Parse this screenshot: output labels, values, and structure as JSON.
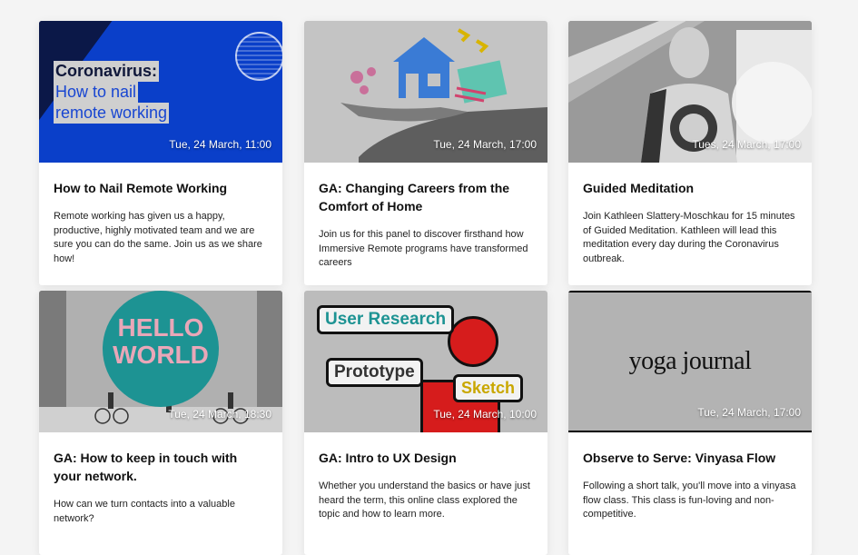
{
  "cards": [
    {
      "date": "Tue, 24 March, 11:00",
      "title": "How to Nail Remote Working",
      "description": "Remote working has given us a happy, productive, highly motivated team and we are sure you can do the same. Join us as we share how!",
      "image": {
        "headline_line1": "Coronavirus:",
        "headline_line2": "How to nail",
        "headline_line3": "remote working"
      }
    },
    {
      "date": "Tue, 24 March, 17:00",
      "title": "GA: Changing Careers from the Comfort of Home",
      "description": "Join us for this panel to discover firsthand how Immersive Remote programs have transformed careers",
      "image": {}
    },
    {
      "date": "Tues, 24 March, 17:00",
      "title": "Guided Meditation",
      "description": "Join Kathleen Slattery-Moschkau for 15 minutes of Guided Meditation. Kathleen will lead this meditation every day during the Coronavirus outbreak.",
      "image": {}
    },
    {
      "date": "Tue, 24 March, 18:30",
      "title": "GA: How to keep in touch with your network.",
      "description": "How can we turn contacts into a valuable network?",
      "image": {
        "sign_line1": "HELLO",
        "sign_line2": "WORLD"
      }
    },
    {
      "date": "Tue, 24 March, 10:00",
      "title": "GA: Intro to UX Design",
      "description": "Whether you understand the basics or have just heard the term, this online class explored the topic and how to learn more.",
      "image": {
        "bubble1": "User Research",
        "bubble2": "Prototype",
        "bubble3": "Sketch"
      }
    },
    {
      "date": "Tue, 24 March, 17:00",
      "title": "Observe to Serve: Vinyasa Flow",
      "description": "Following a short talk, you'll move into a vinyasa flow class. This class is fun-loving and non-competitive.",
      "image": {
        "logo_text": "yoga journal"
      }
    }
  ]
}
